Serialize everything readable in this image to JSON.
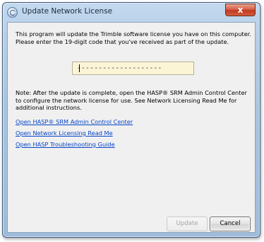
{
  "window": {
    "title": "Update Network License",
    "close_glyph": "x"
  },
  "dialog": {
    "intro_text": "This program will update the Trimble software license you have on this computer. Please enter the 19-digit code that you've received as part of the update.",
    "license_code": {
      "value": "--------------------",
      "placeholder": ""
    },
    "note_text": "Note: After the update is complete, open the HASP® SRM Admin Control Center to configure the network license for use. See Network Licensing Read Me for additional instructions.",
    "links": {
      "hasp_admin": "Open HASP® SRM Admin Control Center",
      "readme": "Open Network Licensing Read Me",
      "troubleshooting": "Open HASP Troubleshooting Guide"
    },
    "buttons": {
      "update": "Update",
      "cancel": "Cancel"
    }
  },
  "icons": {
    "title": "app-icon",
    "close": "close-icon"
  },
  "colors": {
    "link": "#0645c8",
    "field_background": "#fbf5d6",
    "close_button": "#c1391f"
  }
}
